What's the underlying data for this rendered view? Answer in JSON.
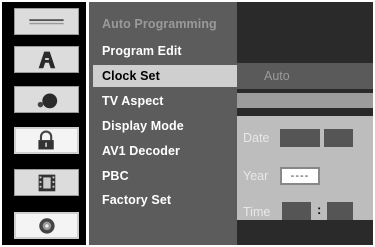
{
  "icons": [
    {
      "name": "menu-lines-icon",
      "style": "light"
    },
    {
      "name": "language-a-icon",
      "style": "light"
    },
    {
      "name": "speaker-icon",
      "style": "light"
    },
    {
      "name": "padlock-icon",
      "style": "white"
    },
    {
      "name": "film-frame-icon",
      "style": "light"
    },
    {
      "name": "disc-icon",
      "style": "white"
    }
  ],
  "menu": {
    "items": [
      {
        "label": "Auto Programming",
        "state": "dim"
      },
      {
        "label": "Program Edit",
        "state": "normal"
      },
      {
        "label": "Clock Set",
        "state": "selected"
      },
      {
        "label": "TV Aspect",
        "state": "normal"
      },
      {
        "label": "Display Mode",
        "state": "normal"
      },
      {
        "label": "AV1 Decoder",
        "state": "normal"
      },
      {
        "label": "PBC",
        "state": "normal"
      },
      {
        "label": "Factory Set",
        "state": "normal"
      }
    ]
  },
  "clock": {
    "mode_value": "Auto",
    "date_label": "Date",
    "year_label": "Year",
    "year_value": "----",
    "time_label": "Time",
    "time_separator": ":"
  },
  "colors": {
    "menu_bg": "#5c5c5c",
    "highlight": "#cfcfcf",
    "right_bg": "#2a2a2a"
  }
}
